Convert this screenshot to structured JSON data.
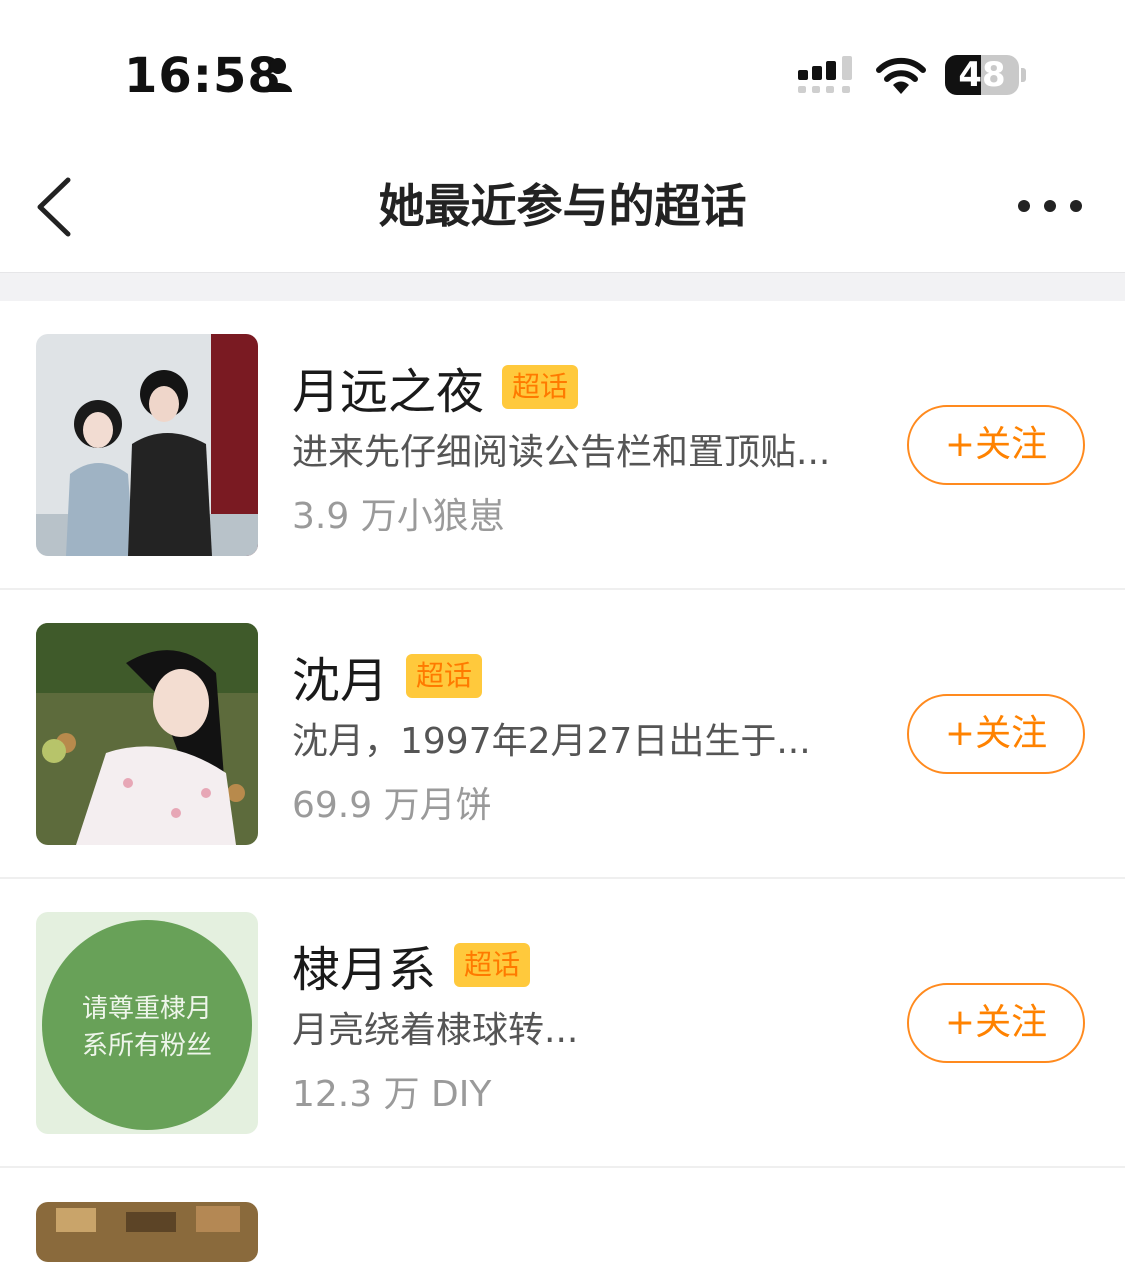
{
  "status_bar": {
    "time": "16:58",
    "battery": "48",
    "battery_level": 0.48
  },
  "nav": {
    "title": "她最近参与的超话",
    "back_icon": "chevron-left-icon",
    "more_icon": "more-dots-icon"
  },
  "colors": {
    "accent": "#ff8200",
    "badge_bg": "#ffc93c",
    "divider": "#f2f2f4"
  },
  "topics": [
    {
      "name": "月远之夜",
      "badge": "超话",
      "desc": "进来先仔细阅读公告栏和置顶贴...",
      "stats": "3.9 万小狼崽",
      "follow": "+关注"
    },
    {
      "name": "沈月",
      "badge": "超话",
      "desc": "沈月，1997年2月27日出生于...",
      "stats": "69.9 万月饼",
      "follow": "+关注"
    },
    {
      "name": "棣月系",
      "badge": "超话",
      "desc": "月亮绕着棣球转...",
      "stats": "12.3 万 DIY",
      "follow": "+关注",
      "thumb_text_1": "请尊重棣月",
      "thumb_text_2": "系所有粉丝"
    }
  ]
}
